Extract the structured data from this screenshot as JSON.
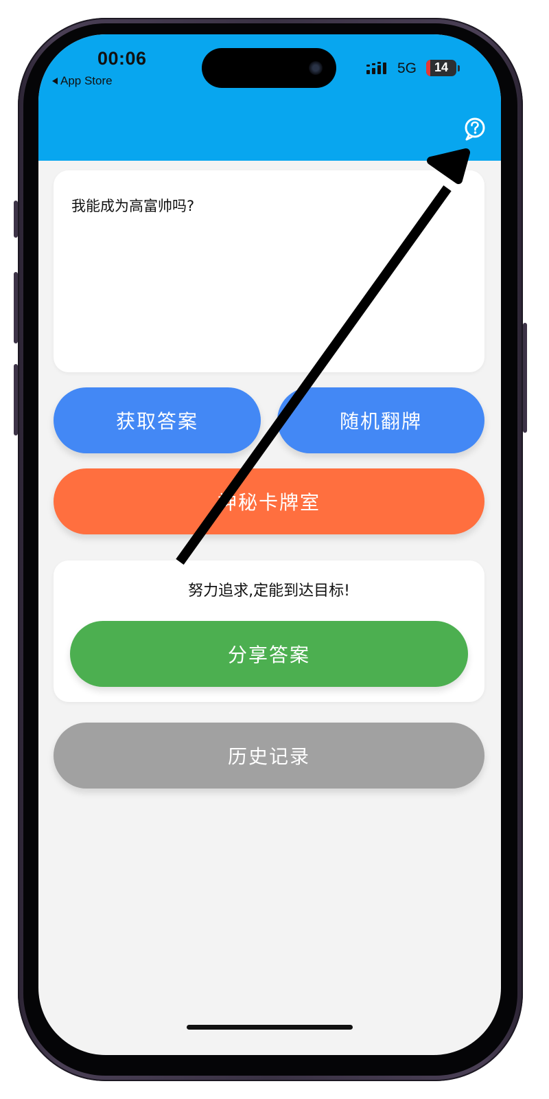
{
  "status_bar": {
    "time": "00:06",
    "back_label": "App Store",
    "network": "5G",
    "battery": "14",
    "battery_level": 0.14
  },
  "header": {
    "help_icon": "help-circle-icon",
    "bar_color": "#08a6ef"
  },
  "question": {
    "text": "我能成为高富帅吗?"
  },
  "buttons": {
    "get_answer": "获取答案",
    "random_flip": "随机翻牌",
    "mystery_room": "神秘卡牌室",
    "share_answer": "分享答案",
    "history": "历史记录"
  },
  "result": {
    "text": "努力追求,定能到达目标!"
  },
  "colors": {
    "primary_blue": "#4388f5",
    "mystery_orange": "#ff6f3f",
    "share_green": "#4caf50",
    "history_gray": "#a1a1a1"
  },
  "annotation": {
    "icon": "arrow-annotation-icon",
    "target": "help-icon"
  }
}
